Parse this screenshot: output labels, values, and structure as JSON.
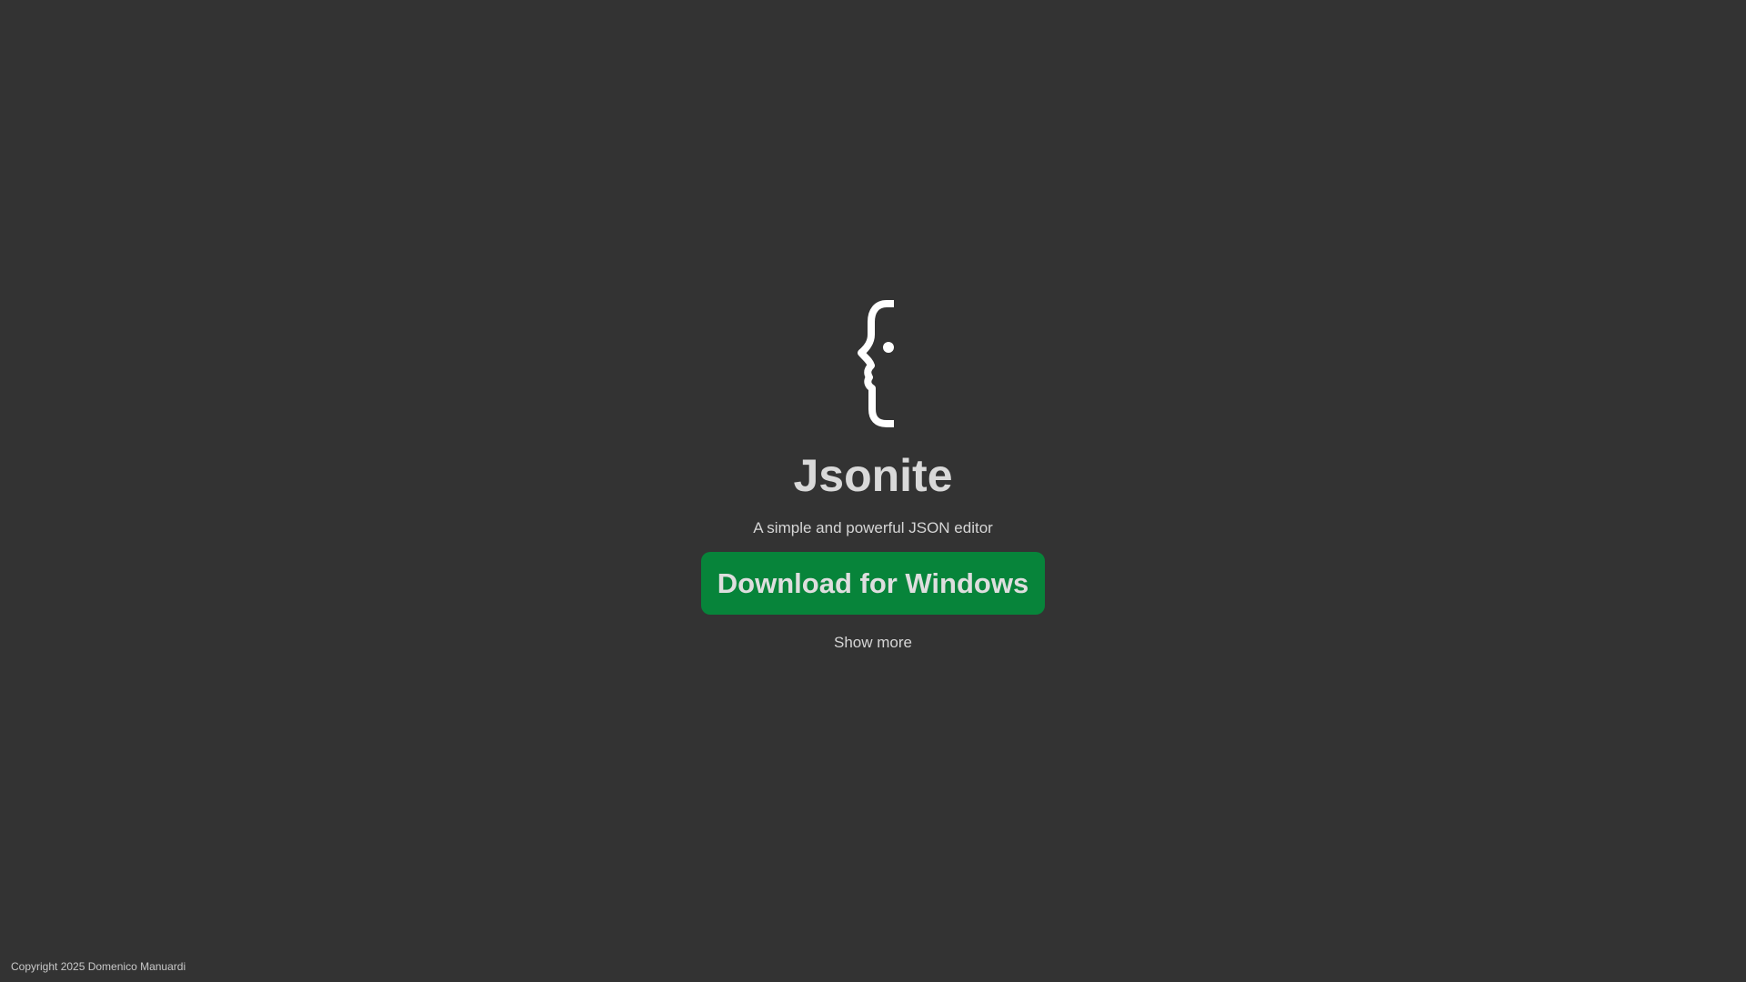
{
  "hero": {
    "logo_icon": "face-brace-icon",
    "title": "Jsonite",
    "tagline": "A simple and powerful JSON editor",
    "download_label": "Download for Windows",
    "show_more_label": "Show more"
  },
  "footer": {
    "copyright": "Copyright 2025 Domenico Manuardi"
  },
  "colors": {
    "background": "#333333",
    "button": "#07843a",
    "text": "#d9d9d9",
    "logo": "#ffffff"
  }
}
